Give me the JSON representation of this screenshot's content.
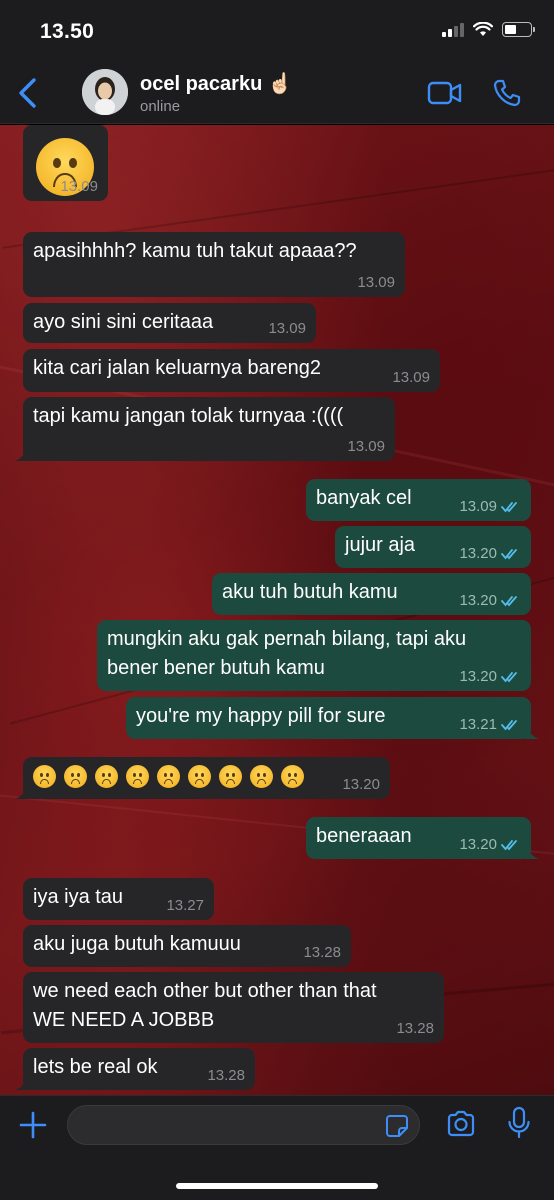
{
  "status_bar": {
    "time": "13.50"
  },
  "header": {
    "contact_name": "ocel pacarku ☝🏻",
    "contact_status": "online"
  },
  "messages": [
    {
      "dir": "in",
      "text": "",
      "time": "13.09",
      "emoji": 1
    },
    {
      "dir": "in",
      "text": "apasihhhh? kamu tuh takut apaaa??",
      "time": "13.09"
    },
    {
      "dir": "in",
      "text": "ayo sini sini ceritaaa",
      "time": "13.09"
    },
    {
      "dir": "in",
      "text": "kita cari jalan keluarnya bareng2",
      "time": "13.09"
    },
    {
      "dir": "in",
      "text": "tapi kamu jangan tolak turnyaa :((((",
      "time": "13.09"
    },
    {
      "dir": "out",
      "text": "banyak cel",
      "time": "13.09",
      "read": true
    },
    {
      "dir": "out",
      "text": "jujur aja",
      "time": "13.20",
      "read": true
    },
    {
      "dir": "out",
      "text": "aku tuh butuh kamu",
      "time": "13.20",
      "read": true
    },
    {
      "dir": "out",
      "text": "mungkin aku gak pernah bilang, tapi aku",
      "text2": "bener bener butuh kamu",
      "time": "13.20",
      "read": true
    },
    {
      "dir": "out",
      "text": "you're my happy pill for sure",
      "time": "13.21",
      "read": true
    },
    {
      "dir": "in",
      "text": "",
      "time": "13.20",
      "emoji": 9
    },
    {
      "dir": "out",
      "text": "beneraaan",
      "time": "13.20",
      "read": true
    },
    {
      "dir": "in",
      "text": "iya iya tau",
      "time": "13.27"
    },
    {
      "dir": "in",
      "text": "aku juga butuh kamuuu",
      "time": "13.28"
    },
    {
      "dir": "in",
      "text": "we need each other but other than that",
      "text2": "WE NEED A JOBBB",
      "time": "13.28"
    },
    {
      "dir": "in",
      "text": "lets be real ok",
      "time": "13.28"
    }
  ],
  "input": {
    "placeholder": ""
  },
  "colors": {
    "accent": "#3e8ef7",
    "incoming_bubble": "#262628",
    "outgoing_bubble": "#1d4a3e",
    "read_tick": "#53bdeb"
  }
}
